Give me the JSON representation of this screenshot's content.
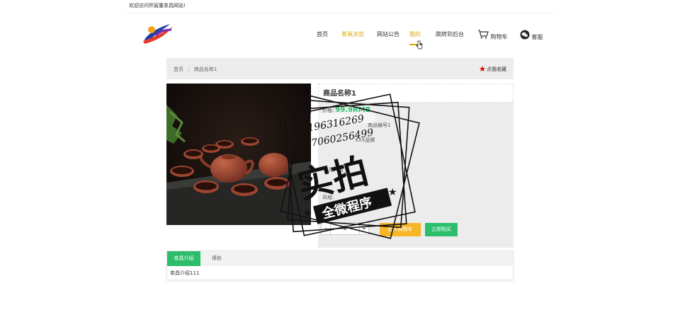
{
  "topbar": {
    "welcome": "欢迎访问怀宸董茶具网站!"
  },
  "nav": {
    "items": [
      {
        "label": "首页",
        "highlight": false
      },
      {
        "label": "茶具浏览",
        "highlight": true
      },
      {
        "label": "网站公告",
        "highlight": false
      },
      {
        "label": "我的",
        "highlight": true
      },
      {
        "label": "跳转到后台",
        "highlight": false
      }
    ],
    "cart_label": "购物车",
    "service_label": "客服",
    "accent_color": "#e0a400"
  },
  "breadcrumb": {
    "home": "首页",
    "separator": "/",
    "current": "商品名称1",
    "favorite": "点我收藏"
  },
  "product": {
    "title": "商品名称1",
    "price_label": "价格:",
    "price_value": "99.9RMB",
    "code_label": "商品编号1",
    "brand_label": "XXX品牌",
    "users_label": "适用人数",
    "style_label": "风格:",
    "qty_minus": "-",
    "qty_value": "1",
    "qty_plus": "+",
    "cart_button": "加入购物车",
    "buy_button": "立即购买"
  },
  "tabs": {
    "items": [
      {
        "label": "茶具介绍",
        "active": true
      },
      {
        "label": "评价",
        "active": false
      }
    ],
    "content": "茶具介绍111"
  },
  "watermark": {
    "phone1": "196316269",
    "phone2": "17060256499",
    "stamp": "实拍",
    "ribbon": "全微程序"
  },
  "colors": {
    "green": "#2dbe6c",
    "orange": "#f7b625",
    "red": "#d40000"
  }
}
